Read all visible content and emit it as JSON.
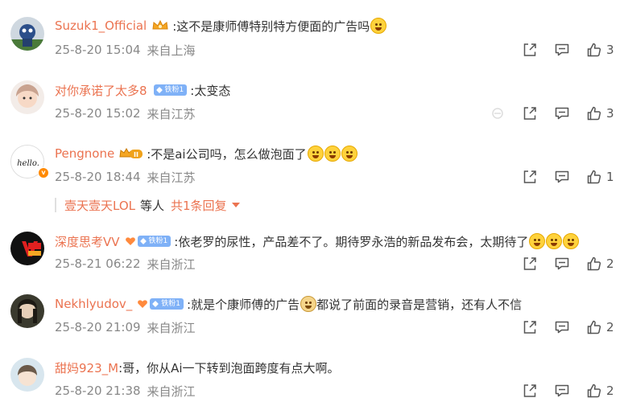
{
  "comments": [
    {
      "user": "Suzuk1_Official",
      "badge": "crown-gold",
      "text": ":这不是康师傅特别特方便面的广告吗",
      "emojis": 1,
      "date": "25-8-20 15:04",
      "location": "来自上海",
      "likes": "3",
      "has_dislike": false
    },
    {
      "user": "对你承诺了太多8",
      "badge": "fan",
      "fan_label": "铁粉1",
      "text": ":太变态",
      "emojis": 0,
      "date": "25-8-20 15:02",
      "location": "来自江苏",
      "likes": "3",
      "has_dislike": true
    },
    {
      "user": "Pengnone",
      "badge": "crown-level",
      "badge_label": "II",
      "text": ":不是ai公司吗，怎么做泡面了",
      "emojis": 3,
      "date": "25-8-20 18:44",
      "location": "来自江苏",
      "likes": "1",
      "has_dislike": false,
      "reply_summary": {
        "user": "壹天壹天LOL",
        "middle": "等人",
        "more": "共1条回复"
      }
    },
    {
      "user": "深度思考VV",
      "badge": "fan",
      "fan_label": "铁粉1",
      "text": ":依老罗的尿性，产品差不了。期待罗永浩的新品发布会，太期待了",
      "emojis": 3,
      "date": "25-8-21 06:22",
      "location": "来自浙江",
      "likes": "2",
      "has_dislike": false
    },
    {
      "user": "Nekhlyudov_",
      "badge": "fan",
      "fan_label": "铁粉1",
      "text": ":就是个康师傅的广告",
      "text2": "都说了前面的录音是营销，还有人不信",
      "emojis": 0,
      "date": "25-8-20 21:09",
      "location": "来自浙江",
      "likes": "2",
      "has_dislike": false
    },
    {
      "user": "甜妈923_M",
      "badge": "none",
      "text": ":哥，你从Ai一下转到泡面跨度有点大啊。",
      "emojis": 0,
      "date": "25-8-20 21:38",
      "location": "来自浙江",
      "likes": "2",
      "has_dislike": false
    }
  ],
  "icons": {
    "share": "share-icon",
    "comment": "comment-icon",
    "like": "like-icon",
    "dislike": "dislike-icon"
  },
  "colors": {
    "username": "#eb7350",
    "meta": "#888888",
    "fan_badge": "#7fb1f7"
  }
}
